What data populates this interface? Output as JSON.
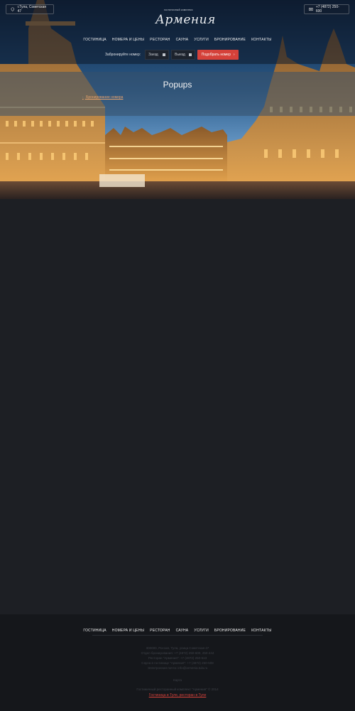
{
  "header": {
    "address": "г.Тула, Советская 47",
    "phone": "+7 (4872) 250-600",
    "logo_small": "гостиничный комплекс",
    "logo_script": "Армения"
  },
  "nav": {
    "items": [
      "ГОСТИНИЦА",
      "НОМЕРА И ЦЕНЫ",
      "РЕСТОРАН",
      "САУНА",
      "УСЛУГИ",
      "БРОНИРОВАНИЕ",
      "КОНТАКТЫ"
    ]
  },
  "booking": {
    "label": "Забронируйте номер:",
    "checkin": "Заезд",
    "checkout": "Выезд",
    "button": "Подобрать номер"
  },
  "page": {
    "title": "Popups",
    "breadcrumb": "Бронирование номера"
  },
  "footer": {
    "nav": [
      "ГОСТИНИЦА",
      "НОМЕРА И ЦЕНЫ",
      "РЕСТОРАН",
      "САУНА",
      "УСЛУГИ",
      "БРОНИРОВАНИЕ",
      "КОНТАКТЫ"
    ],
    "info": [
      "300000, Россия, Тула, улица Советская 47",
      "Отдел бронирования: +7 (4872) 250-600, 250-444",
      "Ресторан \"Армения\": +7 (4872) 250-613",
      "Сауна в гостинице \"Армения\": +7 (4872) 250-508",
      "Электронная почта: info@armenia.tula.ru"
    ],
    "sitemap": "Карта",
    "copyright": "Гостиничный ресторанный комплекс \"Армения\" © 2014",
    "link": "Гостиница в Туле, ресторан в Туле"
  },
  "colors": {
    "accent": "#d5413a",
    "background": "#1d1f24",
    "footer": "#15171b"
  }
}
